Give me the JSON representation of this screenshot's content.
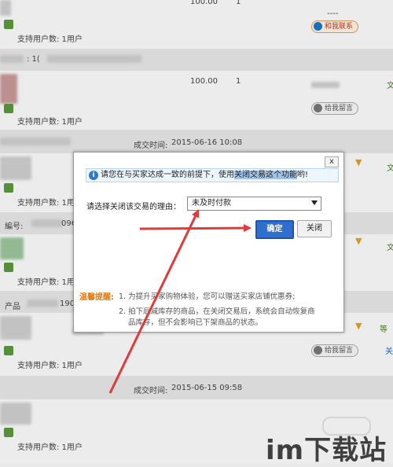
{
  "rows": {
    "support_users": "支持用户数: 1用户",
    "price": "100.00",
    "qty": "1",
    "chat_btn": "和我联系",
    "msg_btn": "给我留言",
    "deal_time_label": "成交时间:",
    "deal_time_1": "2015-06-16 10:08",
    "deal_time_2": "2015-06-15 09:58",
    "side_text": "文",
    "side_text_2": "等",
    "side_text_3": "关",
    "row_id_label": "編号:",
    "row_id_partial": "096",
    "row_id_partial_2": "190",
    "dashes": "----",
    "row_prefix_1": ": 1(",
    "row_prefix_2": "产品"
  },
  "dialog": {
    "close_label": "x",
    "notice_pre": "请您在与买家达成一致的前提下，使用",
    "notice_highlight": "关闭交易这个功能",
    "notice_post": "哟!",
    "info_icon": "i",
    "reason_label": "请选择关闭该交易的理由：",
    "reason_value": "未及时付款",
    "ok_label": "确定",
    "cancel_label": "关闭",
    "tip_label": "温馨提醒:",
    "tip_1": "1. 为提升买家购物体验，您可以赠送买家店铺优惠券;",
    "tip_2a": "2. 拍下后减库存的商品，在关闭交易后，系统会自动恢复商",
    "tip_2b": "品库存，但不会影响已下架商品的状态。"
  },
  "watermark": "im下载站",
  "colors": {
    "primary_button": "#2f6fd0",
    "arrow": "#e03a3a",
    "tip_label": "#e07a10",
    "notice_bg": "#eef6fd"
  }
}
